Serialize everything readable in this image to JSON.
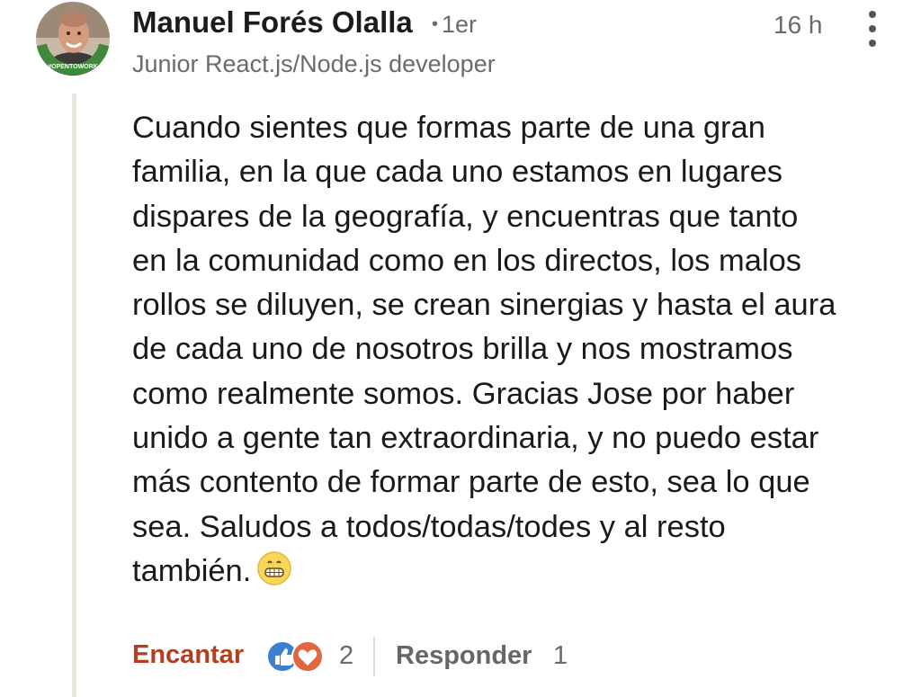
{
  "comment": {
    "author": {
      "name": "Manuel Forés Olalla",
      "connection_degree": "1er",
      "headline": "Junior React.js/Node.js developer",
      "avatar_badge": "#OPENTOWORK"
    },
    "timestamp": "16 h",
    "text_lines": [
      "Cuando sientes que formas parte de una gran",
      "familia, en la que cada uno estamos en lugares",
      "dispares de la geografía, y encuentras que tanto",
      "en la comunidad como en los directos, los malos",
      "rollos se diluyen, se crean sinergias y hasta el aura",
      "de cada uno de nosotros brilla y nos mostramos",
      "como realmente somos. Gracias Jose por haber",
      "unido a gente tan extraordinaria, y no puedo estar",
      "más contento de formar parte de esto, sea lo que",
      "sea. Saludos a todos/todas/todes y al resto",
      "también."
    ],
    "emoji": "grinning-face"
  },
  "actions": {
    "like_label": "Encantar",
    "reaction_count": "2",
    "reply_label": "Responder",
    "reply_count": "1"
  },
  "colors": {
    "like_accent": "#b24020",
    "badge_green": "#3f8a3a",
    "like_blue": "#3a7fd0",
    "love_red": "#e0673f"
  }
}
